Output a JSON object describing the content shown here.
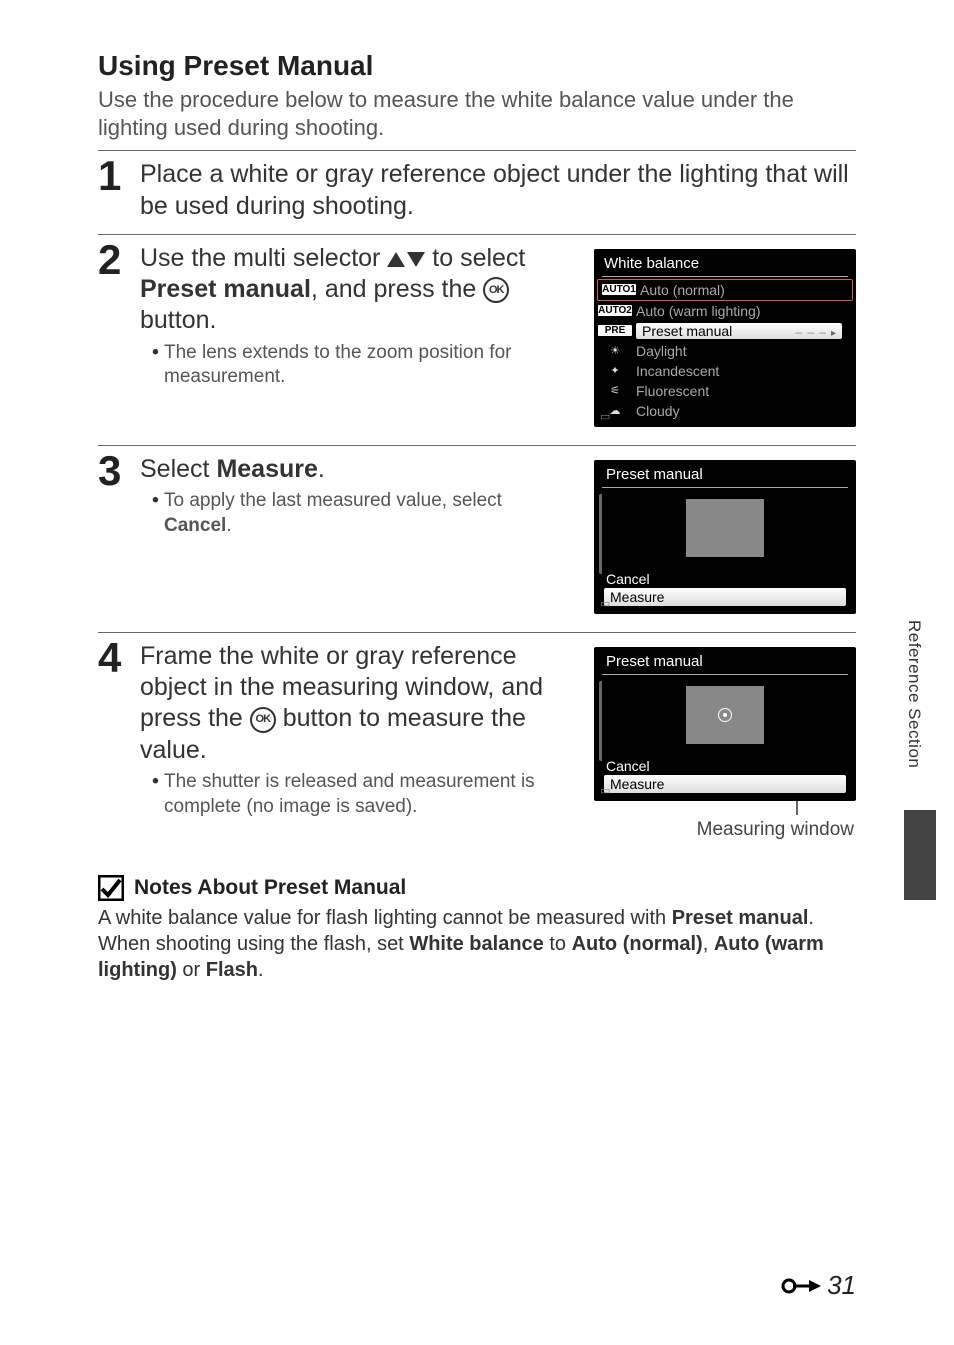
{
  "section_title": "Using Preset Manual",
  "intro": "Use the procedure below to measure the white balance value under the lighting used during shooting.",
  "steps": {
    "1": {
      "head": "Place a white or gray reference object under the lighting that will be used during shooting."
    },
    "2": {
      "head_pre": "Use the multi selector ",
      "head_mid": " to select ",
      "head_bold": "Preset manual",
      "head_post": ", and press the ",
      "head_end": " button.",
      "bullet": "The lens extends to the zoom position for measurement."
    },
    "3": {
      "head_pre": "Select ",
      "head_bold": "Measure",
      "head_post": ".",
      "bullet_pre": "To apply the last measured value, select ",
      "bullet_bold": "Cancel",
      "bullet_post": "."
    },
    "4": {
      "head_pre": "Frame the white or gray reference object in the measuring window, and press the ",
      "head_post": " button to measure the value.",
      "bullet": "The shutter is released and measurement is complete (no image is saved)."
    }
  },
  "wb_screen": {
    "title": "White balance",
    "rows": [
      {
        "icon": "AUTO1",
        "label": "Auto (normal)"
      },
      {
        "icon": "AUTO2",
        "label": "Auto (warm lighting)"
      },
      {
        "icon": "PRE",
        "label": "Preset manual",
        "selected": true
      },
      {
        "icon": "sun",
        "label": "Daylight"
      },
      {
        "icon": "bulb",
        "label": "Incandescent"
      },
      {
        "icon": "tube",
        "label": "Fluorescent"
      },
      {
        "icon": "cloud",
        "label": "Cloudy"
      }
    ]
  },
  "preset_screen_1": {
    "title": "Preset manual",
    "cancel": "Cancel",
    "measure": "Measure"
  },
  "preset_screen_2": {
    "title": "Preset manual",
    "cancel": "Cancel",
    "measure": "Measure"
  },
  "measuring_caption": "Measuring window",
  "callout": {
    "title": "Notes About Preset Manual",
    "body_1": "A white balance value for flash lighting cannot be measured with ",
    "bold_1": "Preset manual",
    "body_2": ". When shooting using the flash, set ",
    "bold_2": "White balance",
    "body_3": " to ",
    "bold_3": "Auto (normal)",
    "body_4": ", ",
    "bold_4": "Auto (warm lighting)",
    "body_5": " or ",
    "bold_5": "Flash",
    "body_6": "."
  },
  "side_label": "Reference Section",
  "page_number": "31"
}
